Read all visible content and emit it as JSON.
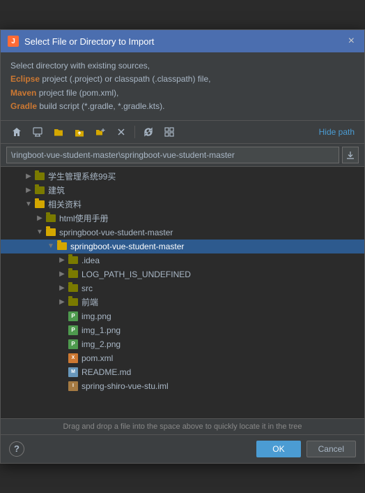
{
  "dialog": {
    "title": "Select File or Directory to Import",
    "close_label": "×"
  },
  "description": {
    "line1": "Select directory with existing sources,",
    "eclipse_label": "Eclipse",
    "line2": " project (.project) or classpath (.classpath) file,",
    "maven_label": "Maven",
    "line3": " project file (pom.xml),",
    "gradle_label": "Gradle",
    "line4": " build script (*.gradle, *.gradle.kts)."
  },
  "toolbar": {
    "hide_path": "Hide path",
    "btn1": "⌂",
    "btn2": "🖥",
    "btn3": "📁",
    "btn4": "📂",
    "btn5": "📁",
    "btn6": "✕",
    "btn7": "↺",
    "btn8": "⊞"
  },
  "path_bar": {
    "value": "\\ringboot-vue-student-master\\springboot-vue-student-master"
  },
  "tree": {
    "items": [
      {
        "indent": 2,
        "arrow": "▶",
        "type": "folder",
        "open": false,
        "name": "学生管理系统99买",
        "selected": false
      },
      {
        "indent": 2,
        "arrow": "▶",
        "type": "folder",
        "open": false,
        "name": "建筑",
        "selected": false
      },
      {
        "indent": 2,
        "arrow": "▼",
        "type": "folder",
        "open": true,
        "name": "相关资料",
        "selected": false
      },
      {
        "indent": 3,
        "arrow": "▶",
        "type": "folder",
        "open": false,
        "name": "html使用手册",
        "selected": false
      },
      {
        "indent": 3,
        "arrow": "▼",
        "type": "folder",
        "open": true,
        "name": "springboot-vue-student-master",
        "selected": false
      },
      {
        "indent": 4,
        "arrow": "▼",
        "type": "folder",
        "open": true,
        "name": "springboot-vue-student-master",
        "selected": true
      },
      {
        "indent": 5,
        "arrow": "▶",
        "type": "folder",
        "open": false,
        "name": ".idea",
        "selected": false
      },
      {
        "indent": 5,
        "arrow": "▶",
        "type": "folder",
        "open": false,
        "name": "LOG_PATH_IS_UNDEFINED",
        "selected": false
      },
      {
        "indent": 5,
        "arrow": "▶",
        "type": "folder",
        "open": false,
        "name": "src",
        "selected": false
      },
      {
        "indent": 5,
        "arrow": "▶",
        "type": "folder",
        "open": false,
        "name": "前端",
        "selected": false
      },
      {
        "indent": 5,
        "arrow": "",
        "type": "png",
        "open": false,
        "name": "img.png",
        "selected": false
      },
      {
        "indent": 5,
        "arrow": "",
        "type": "png",
        "open": false,
        "name": "img_1.png",
        "selected": false
      },
      {
        "indent": 5,
        "arrow": "",
        "type": "png",
        "open": false,
        "name": "img_2.png",
        "selected": false
      },
      {
        "indent": 5,
        "arrow": "",
        "type": "xml",
        "open": false,
        "name": "pom.xml",
        "selected": false
      },
      {
        "indent": 5,
        "arrow": "",
        "type": "md",
        "open": false,
        "name": "README.md",
        "selected": false
      },
      {
        "indent": 5,
        "arrow": "",
        "type": "iml",
        "open": false,
        "name": "spring-shiro-vue-stu.iml",
        "selected": false
      }
    ]
  },
  "status_bar": {
    "text": "Drag and drop a file into the space above to quickly locate it in the tree"
  },
  "buttons": {
    "help": "?",
    "ok": "OK",
    "cancel": "Cancel"
  }
}
